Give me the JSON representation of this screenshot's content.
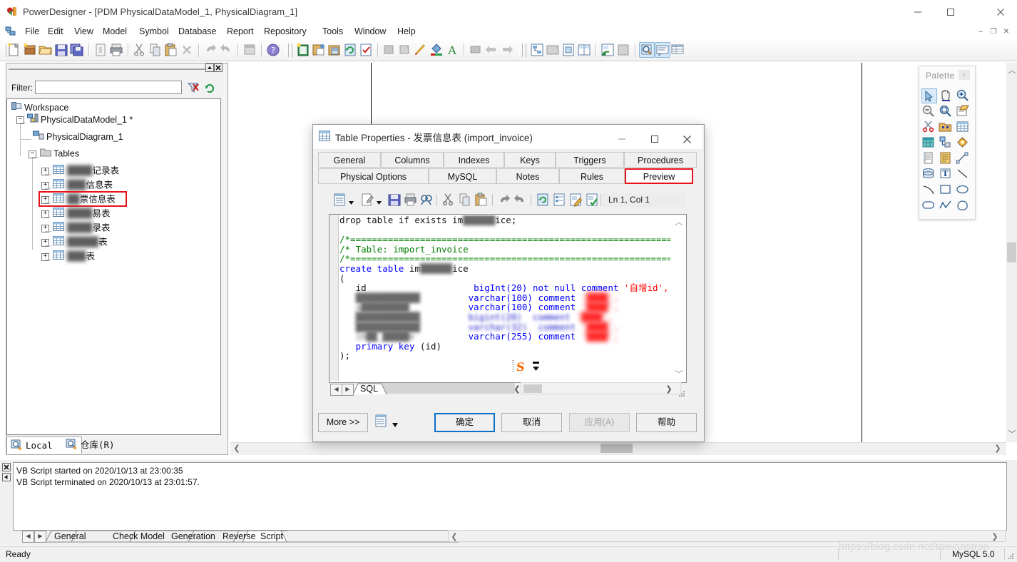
{
  "window": {
    "title": "PowerDesigner - [PDM PhysicalDataModel_1, PhysicalDiagram_1]",
    "app_icon": "powerdesigner-icon",
    "minimize": "–",
    "maximize": "□",
    "close": "✕"
  },
  "menubar": {
    "items": [
      "File",
      "Edit",
      "View",
      "Model",
      "Symbol",
      "Database",
      "Report",
      "Repository",
      "Tools",
      "Window",
      "Help"
    ],
    "mdi_minimize": "–",
    "mdi_restore": "❐",
    "mdi_close": "✕"
  },
  "toolbar": {
    "groups": [
      [
        "new-model-icon",
        "new-package-icon",
        "open-icon",
        "save-icon",
        "save-all-icon"
      ],
      [
        "print-preview-icon",
        "print-icon"
      ],
      [
        "cut-icon",
        "copy-icon",
        "paste-icon",
        "delete-icon"
      ],
      [
        "undo-icon",
        "redo-icon"
      ],
      [
        "properties-icon"
      ],
      [
        "help-icon"
      ],
      [
        "new-table-icon",
        "generate-database-icon",
        "reverse-engineer-icon",
        "refresh-icon",
        "check-model-icon"
      ],
      [
        "group-icon",
        "ungroup-icon",
        "format-brush-icon",
        "fill-color-icon",
        "font-color-icon"
      ],
      [
        "zoom-icon",
        "back-icon",
        "forward-icon"
      ],
      [
        "diagram-icon",
        "package-diagram-icon",
        "new-diagram-icon",
        "tile-diagram-icon"
      ],
      [
        "display-preferences-icon",
        "auto-layout-icon"
      ],
      [
        "browser-toggle-icon",
        "output-toggle-icon",
        "result-list-icon"
      ]
    ]
  },
  "browser": {
    "filter_label": "Filter:",
    "filter_value": "",
    "filter_placeholder": "",
    "clear_filter_icon": "clear-filter-icon",
    "refresh_icon": "refresh-icon",
    "tree": [
      {
        "label": "Workspace",
        "depth": 0,
        "icon": "workspace-icon",
        "expander": null
      },
      {
        "label": "PhysicalDataModel_1 *",
        "depth": 1,
        "icon": "pdm-icon",
        "expander": "-"
      },
      {
        "label": "PhysicalDiagram_1",
        "depth": 2,
        "icon": "diagram-icon",
        "expander": null
      },
      {
        "label": "Tables",
        "depth": 2,
        "icon": "folder-icon",
        "expander": "-"
      },
      {
        "label": "记录表",
        "depth": 3,
        "icon": "table-icon",
        "expander": "+",
        "blurred_prefix": "████"
      },
      {
        "label": "信息表",
        "depth": 3,
        "icon": "table-icon",
        "expander": "+",
        "blurred_prefix": "███"
      },
      {
        "label": "票信息表",
        "depth": 3,
        "icon": "table-icon",
        "expander": "+",
        "blurred_prefix": "██",
        "selected": true
      },
      {
        "label": "易表",
        "depth": 3,
        "icon": "table-icon",
        "expander": "+",
        "blurred_prefix": "████"
      },
      {
        "label": "录表",
        "depth": 3,
        "icon": "table-icon",
        "expander": "+",
        "blurred_prefix": "████"
      },
      {
        "label": "表",
        "depth": 3,
        "icon": "table-icon",
        "expander": "+",
        "blurred_prefix": "█████"
      },
      {
        "label": "表",
        "depth": 3,
        "icon": "table-icon",
        "expander": "+",
        "blurred_prefix": "███"
      }
    ],
    "tabs": [
      {
        "label": "Local",
        "icon": "local-icon",
        "active": true
      },
      {
        "label": "仓库(R)",
        "icon": "repository-icon",
        "active": false
      }
    ]
  },
  "palette": {
    "title": "Palette",
    "close": "×",
    "tools": [
      {
        "name": "pointer-icon",
        "selected": true
      },
      {
        "name": "grabber-hand-icon",
        "selected": false
      },
      {
        "name": "zoom-in-icon",
        "selected": false
      },
      {
        "name": "zoom-out-icon",
        "selected": false
      },
      {
        "name": "zoom-page-icon",
        "selected": false
      },
      {
        "name": "open-package-icon",
        "selected": false
      },
      {
        "name": "delete-scissors-icon",
        "selected": false
      },
      {
        "name": "package-icon",
        "selected": false
      },
      {
        "name": "table-icon",
        "selected": false
      },
      {
        "name": "view-icon",
        "selected": false
      },
      {
        "name": "reference-icon",
        "selected": false
      },
      {
        "name": "procedure-icon",
        "selected": false
      },
      {
        "name": "file-icon",
        "selected": false
      },
      {
        "name": "note-icon",
        "selected": false
      },
      {
        "name": "link-icon",
        "selected": false
      },
      {
        "name": "database-icon",
        "selected": false
      },
      {
        "name": "text-icon",
        "selected": false
      },
      {
        "name": "line-icon",
        "selected": false
      },
      {
        "name": "arc-icon",
        "selected": false
      },
      {
        "name": "rectangle-icon",
        "selected": false
      },
      {
        "name": "ellipse-icon",
        "selected": false
      },
      {
        "name": "rounded-rect-icon",
        "selected": false
      },
      {
        "name": "polyline-icon",
        "selected": false
      },
      {
        "name": "polygon-icon",
        "selected": false
      }
    ]
  },
  "dialog": {
    "title": "Table Properties - 发票信息表 (import_invoice)",
    "icon": "table-properties-icon",
    "minimize": "–",
    "maximize": "□",
    "close": "✕",
    "tabs_row1": [
      "General",
      "Columns",
      "Indexes",
      "Keys",
      "Triggers",
      "Procedures"
    ],
    "tabs_row2": [
      "Physical Options",
      "MySQL",
      "Notes",
      "Rules",
      "Preview"
    ],
    "active_tab": "Preview",
    "highlight_color": "#e8131a",
    "editor_toolbar": {
      "items": [
        "save-as-icon",
        "edit-with-icon",
        "save-icon",
        "print-icon",
        "find-icon",
        "cut-icon",
        "copy-icon",
        "paste-icon",
        "undo-icon",
        "redo-icon",
        "refresh-icon",
        "properties-icon",
        "edit-icon",
        "check-icon"
      ],
      "position_label": "Ln 1, Col 1"
    },
    "sql_lines": [
      [
        {
          "t": "drop table if exists im",
          "c": "pl"
        },
        {
          "t": "██████",
          "c": "blur"
        },
        {
          "t": "ice;",
          "c": "pl"
        }
      ],
      [],
      [
        {
          "t": "/*==============================================================*/",
          "c": "cm"
        }
      ],
      [
        {
          "t": "/* Table: import_invoice                                        */",
          "c": "cm"
        }
      ],
      [
        {
          "t": "/*==============================================================*/",
          "c": "cm"
        }
      ],
      [
        {
          "t": "create table ",
          "c": "kw"
        },
        {
          "t": "im",
          "c": "pl"
        },
        {
          "t": "██████",
          "c": "blur"
        },
        {
          "t": "ice",
          "c": "pl"
        }
      ],
      [
        {
          "t": "(",
          "c": "pl"
        }
      ],
      [
        {
          "t": "   id                    ",
          "c": "pl"
        },
        {
          "t": "bigInt(20)",
          "c": "kw"
        },
        {
          "t": " ",
          "c": "pl"
        },
        {
          "t": "not null",
          "c": "kw"
        },
        {
          "t": " ",
          "c": "pl"
        },
        {
          "t": "comment",
          "c": "kw"
        },
        {
          "t": " '自增id',",
          "c": "str"
        }
      ],
      [
        {
          "t": "   ████████████         ",
          "c": "blur"
        },
        {
          "t": "varchar(100)",
          "c": "kw"
        },
        {
          "t": " ",
          "c": "pl"
        },
        {
          "t": "comment",
          "c": "kw"
        },
        {
          "t": " '████',",
          "c": "redblur"
        }
      ],
      [
        {
          "t": "   a█████████           ",
          "c": "blur"
        },
        {
          "t": "varchar(100)",
          "c": "kw"
        },
        {
          "t": " ",
          "c": "pl"
        },
        {
          "t": "comment",
          "c": "kw"
        },
        {
          "t": " '████',",
          "c": "redblur"
        }
      ],
      [
        {
          "t": "   ████████████         ",
          "c": "blur"
        },
        {
          "t": "bigint(20)",
          "c": "blurkw"
        },
        {
          "t": "  ",
          "c": "pl"
        },
        {
          "t": "comment",
          "c": "blurkw"
        },
        {
          "t": " '████',",
          "c": "redblur"
        }
      ],
      [
        {
          "t": "   ████████████         ",
          "c": "blur"
        },
        {
          "t": "varchar(32)",
          "c": "blurkw"
        },
        {
          "t": "  ",
          "c": "pl"
        },
        {
          "t": "comment",
          "c": "blurkw"
        },
        {
          "t": " '████',",
          "c": "redblur"
        }
      ],
      [
        {
          "t": "   im██_█████e          ",
          "c": "blur"
        },
        {
          "t": "varchar(255)",
          "c": "kw"
        },
        {
          "t": " ",
          "c": "pl"
        },
        {
          "t": "comment",
          "c": "kw"
        },
        {
          "t": " '████',",
          "c": "redblur"
        }
      ],
      [
        {
          "t": "   ",
          "c": "pl"
        },
        {
          "t": "primary key",
          "c": "kw"
        },
        {
          "t": " (id)",
          "c": "pl"
        }
      ],
      [
        {
          "t": ");",
          "c": "pl"
        }
      ]
    ],
    "sql_tab": "SQL",
    "buttons": [
      {
        "label": "More >>",
        "name": "more-button",
        "state": "normal"
      },
      {
        "label": "确定",
        "name": "ok-button",
        "state": "primary"
      },
      {
        "label": "取消",
        "name": "cancel-button",
        "state": "normal"
      },
      {
        "label": "应用(A)",
        "name": "apply-button",
        "state": "disabled"
      },
      {
        "label": "帮助",
        "name": "help-button",
        "state": "normal"
      }
    ],
    "generate_icon": "generate-script-icon"
  },
  "output": {
    "lines": [
      "VB Script started on 2020/10/13 at 23:00:35",
      "VB Script terminated on 2020/10/13 at 23:01:57."
    ],
    "tabs": [
      "General",
      "Check Model",
      "Generation",
      "Reverse",
      "Script"
    ],
    "active_tab": "Script",
    "close": "✕"
  },
  "statusbar": {
    "text": "Ready",
    "dbms": "MySQL 5.0"
  },
  "watermark": "https://blog.csdn.net/taiwanstron"
}
